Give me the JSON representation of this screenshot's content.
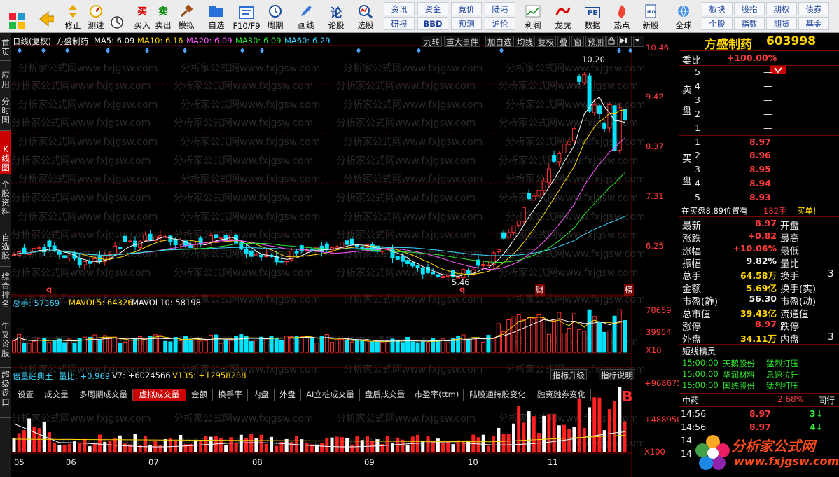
{
  "toolbar": {
    "items": [
      {
        "label": "",
        "icon": "grid-icon"
      },
      {
        "label": "",
        "icon": "back-arrow-icon"
      },
      {
        "label": "修正",
        "icon": "up-down-arrows-icon"
      },
      {
        "label": "测速",
        "icon": "speed-icon"
      },
      {
        "label": "买入",
        "icon": "buy-icon",
        "glyph": "买"
      },
      {
        "label": "卖出",
        "icon": "sell-icon",
        "glyph": "卖"
      },
      {
        "label": "模拟",
        "icon": "hammer-icon"
      },
      {
        "label": "自选",
        "icon": "folder-icon"
      },
      {
        "label": "F10/F9",
        "icon": "f10-icon"
      },
      {
        "label": "周期",
        "icon": "clock-icon"
      },
      {
        "label": "画线",
        "icon": "pen-icon"
      },
      {
        "label": "论股",
        "icon": "comment-icon",
        "glyph": "论"
      },
      {
        "label": "选股",
        "icon": "magnifier-icon"
      },
      {
        "label": "利润",
        "icon": "profit-icon"
      },
      {
        "label": "龙虎",
        "icon": "dragon-icon"
      },
      {
        "label": "数据",
        "icon": "data-icon",
        "glyph": "PE"
      },
      {
        "label": "热点",
        "icon": "fire-icon"
      },
      {
        "label": "新股",
        "icon": "ipo-icon"
      },
      {
        "label": "全球",
        "icon": "globe-icon"
      }
    ],
    "quick": [
      [
        "资讯",
        "资金",
        "竞价",
        "陆港"
      ],
      [
        "研报",
        "BBD",
        "预测",
        "沪伦"
      ]
    ],
    "quick_right": [
      [
        "板块",
        "股指",
        "期权",
        "债券"
      ],
      [
        "个股",
        "指数",
        "期货",
        "基金"
      ]
    ]
  },
  "leftnav": [
    "首页",
    "应用",
    "分时图",
    "K线图",
    "个股资料",
    "自选股",
    "综合排名",
    "牛叉诊股",
    "超级盘口"
  ],
  "chart": {
    "header": {
      "title": "日线(复权)",
      "name": "方盛制药",
      "ma5": "MA5: 6.09",
      "ma10": "MA10: 6.16",
      "ma20": "MA20: 6.09",
      "ma30": "MA30: 6.09",
      "ma60": "MA60: 6.29"
    },
    "header_buttons": [
      "九转",
      "重大事件",
      "加自选",
      "均线",
      "复权",
      "叠",
      "窗",
      "预测"
    ],
    "price_axis": [
      "10.46",
      "9.42",
      "8.37",
      "7.31",
      "6.25"
    ],
    "high_label": "10.20",
    "low_label": "5.46",
    "markers": [
      "q",
      "q",
      "财",
      "榜"
    ],
    "vol_header": {
      "total": "总手: 57369",
      "mavol5": "MAVOL5: 64326",
      "mavol10": "MAVOL10: 58198"
    },
    "vol_axis": [
      "78659",
      "39954",
      "X10"
    ],
    "tabs": [
      "设置",
      "成交量",
      "多周期成交量",
      "虚拟成交量",
      "金额",
      "换手率",
      "内盘",
      "外盘",
      "AI立桩成交量",
      "盘后成交量",
      "市盈率(ttm)",
      "陆股通持股变化",
      "融资融券变化"
    ],
    "active_tab": "虚拟成交量",
    "ind_header": {
      "name": "倍量经典王",
      "ratio": "量比: +0.969",
      "v7": "V7: +6024566",
      "v135": "V135: +12958288"
    },
    "ind_buttons": [
      "指标升级",
      "指标说明"
    ],
    "ind_axis": [
      "+968675",
      "+488950",
      "X100"
    ],
    "ind_signal": "B",
    "x_months": [
      "05",
      "06",
      "07",
      "08",
      "09",
      "10",
      "11"
    ],
    "watermark": "分析家公式网www.fxjgsw.com"
  },
  "right": {
    "stock_name": "方盛制药",
    "stock_code": "603998",
    "weibi_label": "委比",
    "weibi": "+100.00%",
    "sell_label": [
      "卖",
      "盘"
    ],
    "sell": [
      {
        "lv": "5",
        "price": "—"
      },
      {
        "lv": "4",
        "price": "—"
      },
      {
        "lv": "3",
        "price": "—"
      },
      {
        "lv": "2",
        "price": "—"
      },
      {
        "lv": "1",
        "price": "—"
      }
    ],
    "buy_label": [
      "买",
      "盘"
    ],
    "buy": [
      {
        "lv": "1",
        "price": "8.97"
      },
      {
        "lv": "2",
        "price": "8.96"
      },
      {
        "lv": "3",
        "price": "8.95"
      },
      {
        "lv": "4",
        "price": "8.94"
      },
      {
        "lv": "5",
        "price": "8.93"
      }
    ],
    "order_line": "在买盘8.89位置有",
    "order_qty": "182手",
    "order_tag": "买单!",
    "quote": [
      {
        "l": "最新",
        "v": "8.97",
        "c": "red",
        "l2": "开盘"
      },
      {
        "l": "涨跌",
        "v": "+0.82",
        "c": "red",
        "l2": "最高"
      },
      {
        "l": "涨幅",
        "v": "+10.06%",
        "c": "red",
        "l2": "最低"
      },
      {
        "l": "振幅",
        "v": "9.82%",
        "c": "wht",
        "l2": "量比"
      },
      {
        "l": "总手",
        "v": "64.58万",
        "c": "yel",
        "l2": "换手"
      },
      {
        "l": "金额",
        "v": "5.69亿",
        "c": "yel",
        "l2": "换手(实)"
      },
      {
        "l": "市盈(静)",
        "v": "56.30",
        "c": "wht",
        "l2": "市盈(动)"
      },
      {
        "l": "总市值",
        "v": "39.43亿",
        "c": "yel",
        "l2": "流通值"
      },
      {
        "l": "涨停",
        "v": "8.97",
        "c": "red",
        "l2": "跌停"
      },
      {
        "l": "外盘",
        "v": "34.11万",
        "c": "yel",
        "l2": "内盘"
      }
    ],
    "quote_right_partial": [
      "3",
      "3"
    ],
    "elf_title": "短线精灵",
    "elf": [
      {
        "t": "15:00:00",
        "n": "天鹅股份",
        "e": "猛烈打压"
      },
      {
        "t": "15:00:00",
        "n": "华润材料",
        "e": "急速拉升"
      },
      {
        "t": "15:00:00",
        "n": "国统股份",
        "e": "猛烈打压"
      }
    ],
    "sector": {
      "name": "中药",
      "pct": "2.68%",
      "peer": "同行"
    },
    "ticks": [
      {
        "t": "14:56",
        "p": "8.97",
        "q": "3"
      },
      {
        "t": "14:56",
        "p": "8.97",
        "q": "4"
      },
      {
        "t": "14",
        "p": "",
        "q": ""
      },
      {
        "t": "14",
        "p": "",
        "q": ""
      }
    ],
    "logo_text": "分析家公式网",
    "logo_url": "www.fxjgsw.com"
  }
}
